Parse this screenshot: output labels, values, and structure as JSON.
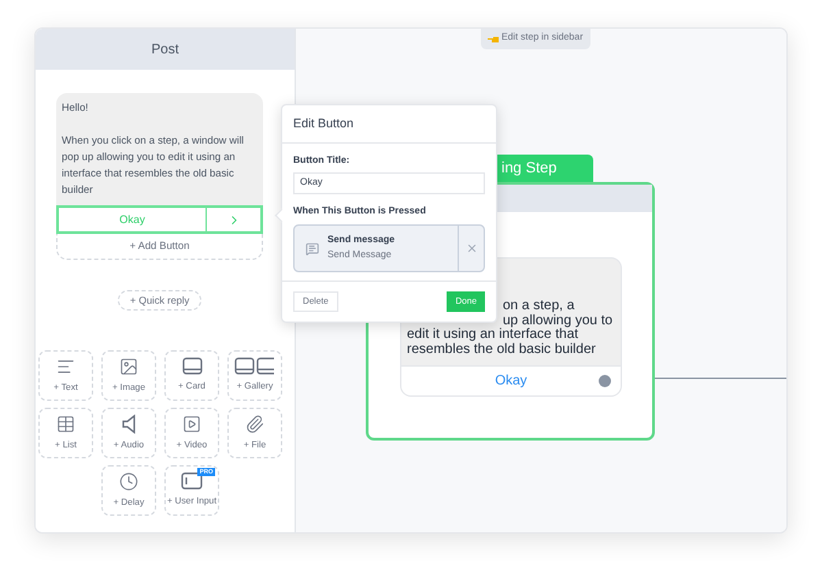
{
  "sidebar": {
    "title": "Post",
    "message": {
      "greeting": "Hello!",
      "body": "When you click on a step, a window will pop up allowing you to edit it using an interface that resembles the old basic builder",
      "button": {
        "label": "Okay",
        "selected": true
      }
    },
    "add_button": "+ Add Button",
    "quick_reply": "+ Quick reply",
    "tools": [
      {
        "kind": "text",
        "label": "+ Text"
      },
      {
        "kind": "image",
        "label": "+ Image"
      },
      {
        "kind": "card",
        "label": "+ Card"
      },
      {
        "kind": "gallery",
        "label": "+ Gallery"
      },
      {
        "kind": "list",
        "label": "+ List"
      },
      {
        "kind": "audio",
        "label": "+ Audio"
      },
      {
        "kind": "video",
        "label": "+ Video"
      },
      {
        "kind": "file",
        "label": "+ File"
      },
      {
        "kind": "delay",
        "label": "+ Delay"
      },
      {
        "kind": "input",
        "label": "+ User Input",
        "badge": "PRO"
      }
    ]
  },
  "canvas": {
    "hint": "Edit step in sidebar",
    "node": {
      "title": "ing Step",
      "lines": [
        {
          "text": "on a step, a",
          "covered": true
        },
        {
          "text": "up allowing you to",
          "covered": true
        },
        {
          "text": "edit it using an interface that",
          "covered": false
        },
        {
          "text": "resembles the old basic builder",
          "covered": false
        }
      ],
      "button": "Okay"
    }
  },
  "popover": {
    "title": "Edit Button",
    "field_label": "Button Title:",
    "field_value": "Okay",
    "action_label": "When This Button is Pressed",
    "action": {
      "title": "Send message",
      "subtitle": "Send Message"
    },
    "delete": "Delete",
    "done": "Done"
  }
}
